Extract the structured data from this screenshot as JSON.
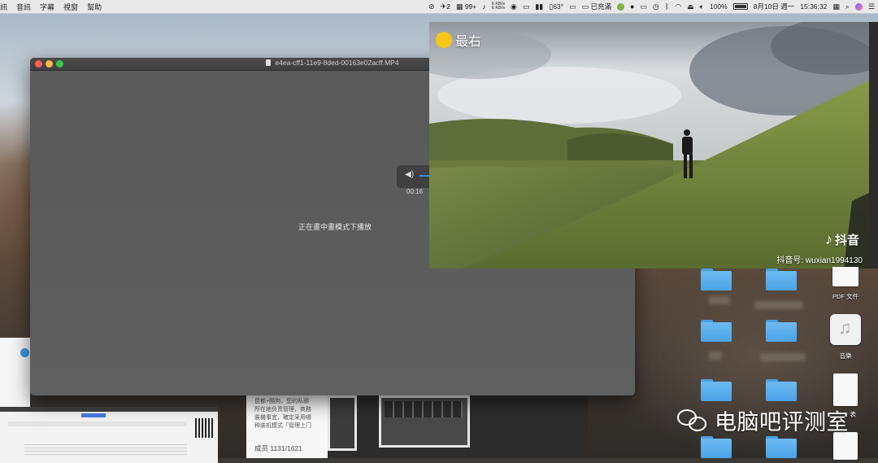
{
  "menubar": {
    "menus": [
      "訊",
      "音訊",
      "字幕",
      "視窗",
      "幫助"
    ],
    "status": {
      "badge_a": "2",
      "badge_b": "99+",
      "net_up": "6 KB/s",
      "net_down": "6 KB/s",
      "temperature": "63°",
      "charging": "已充滿",
      "battery": "100%",
      "date": "8月10日 週一",
      "time": "15:36:32"
    }
  },
  "quicktime": {
    "title": "e4ea-cff1-11e9-8ded-00163e02acff.MP4",
    "message": "正在畫中畫模式下播放"
  },
  "pip": {
    "tag": "最右",
    "brand": "抖音",
    "account": "抖音号: wuxian1994130",
    "timecode": "00:16"
  },
  "background_app": {
    "chat_text_1": "昆都+酷狗，您的私聊",
    "chat_text_2": "所在地负责管理，商務",
    "chat_text_3": "裝機事宜，確定采用哪",
    "chat_text_4": "种装机模式「管理上门",
    "members": "成员 1131/1621"
  },
  "desktop": {
    "pdf_label": "PDF 文件",
    "music_label": "音樂",
    "partial_label": "表"
  },
  "watermark": {
    "text": "电脑吧评测室"
  },
  "colors": {
    "accent": "#2d8de8",
    "folder": "#5aaeec",
    "close": "#fc605c",
    "minimize": "#fdbc40",
    "zoom": "#34c84a"
  }
}
